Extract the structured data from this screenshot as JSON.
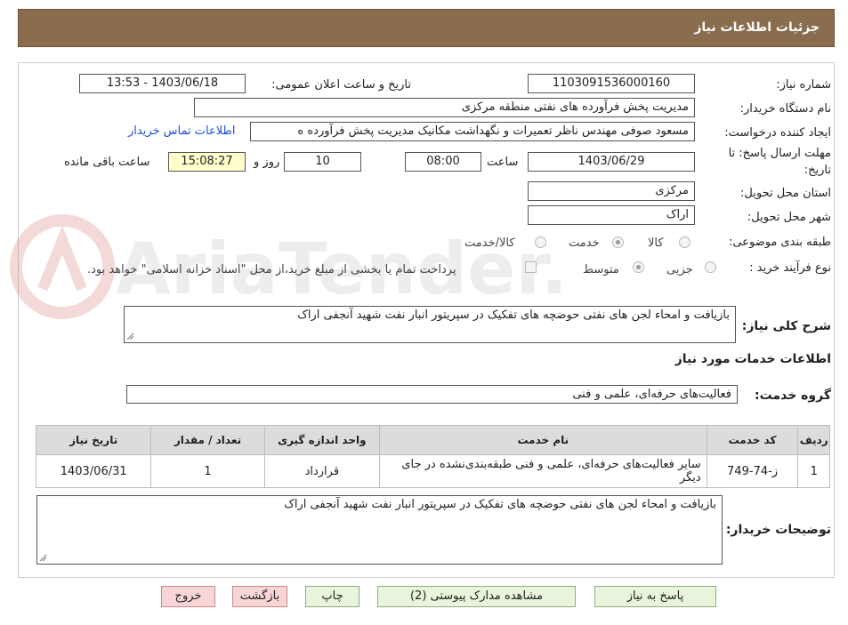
{
  "header": {
    "title": "جزئیات اطلاعات نیاز"
  },
  "watermark": {
    "text": "AriaTender.neT"
  },
  "form": {
    "need_number_label": "شماره نیاز:",
    "need_number": "1103091536000160",
    "announce_label": "تاریخ و ساعت اعلان عمومی:",
    "announce_value": "1403/06/18 - 13:53",
    "buyer_org_label": "نام دستگاه خریدار:",
    "buyer_org": "مدیریت پخش فرآورده های نفتی منطقه مرکزی",
    "creator_label": "ایجاد کننده درخواست:",
    "creator": "مسعود صوفی مهندس ناظر تعمیرات و نگهداشت مکانیک مدیریت پخش فرآورده ه",
    "contact_link": "اطلاعات تماس خریدار",
    "deadline_label_1": "مهلت ارسال پاسخ: تا",
    "deadline_label_2": "تاریخ:",
    "deadline_date": "1403/06/29",
    "time_label": "ساعت",
    "deadline_time": "08:00",
    "days_value": "10",
    "days_label": "روز و",
    "remaining_time": "15:08:27",
    "remaining_label": "ساعت باقی مانده",
    "province_label": "استان محل تحویل:",
    "province": "مرکزی",
    "city_label": "شهر محل تحویل:",
    "city": "اراک",
    "category_label": "طبقه بندی موضوعی:",
    "category_options": [
      "کالا",
      "خدمت",
      "کالا/خدمت"
    ],
    "category_selected": "خدمت",
    "process_label": "نوع فرآیند خرید :",
    "process_options": [
      "جزیی",
      "متوسط"
    ],
    "process_selected": "متوسط",
    "payment_note": "پرداخت تمام یا بخشی از مبلغ خرید،از محل \"اسناد خزانه اسلامی\" خواهد بود.",
    "description_label": "شرح کلی نیاز:",
    "description": "بازیافت و امحاء لجن های نفتی حوضچه های تفکیک در سپریتور انبار نفت شهید آنجفی اراک"
  },
  "services": {
    "section_title": "اطلاعات خدمات مورد نیاز",
    "group_label": "گروه خدمت:",
    "group_value": "فعالیت‌های حرفه‌ای، علمی و فنی",
    "columns": [
      "ردیف",
      "کد خدمت",
      "نام خدمت",
      "واحد اندازه گیری",
      "تعداد / مقدار",
      "تاریخ نیاز"
    ],
    "rows": [
      {
        "index": "1",
        "code": "ز-74-749",
        "name": "سایر فعالیت‌های حرفه‌ای، علمی و فنی طبقه‌بندی‌نشده در جای دیگر",
        "unit": "قرارداد",
        "quantity": "1",
        "date": "1403/06/31"
      }
    ]
  },
  "buyer_notes": {
    "label": "توضیحات خریدار:",
    "text": "بازیافت و امحاء لجن های نفتی حوضچه های تفکیک در سپریتور انبار نفت شهید آنجفی اراک"
  },
  "buttons": {
    "reply": "پاسخ به نیاز",
    "attachments": "مشاهده مدارک پیوستی (2)",
    "print": "چاپ",
    "back": "بازگشت",
    "exit": "خروج"
  }
}
